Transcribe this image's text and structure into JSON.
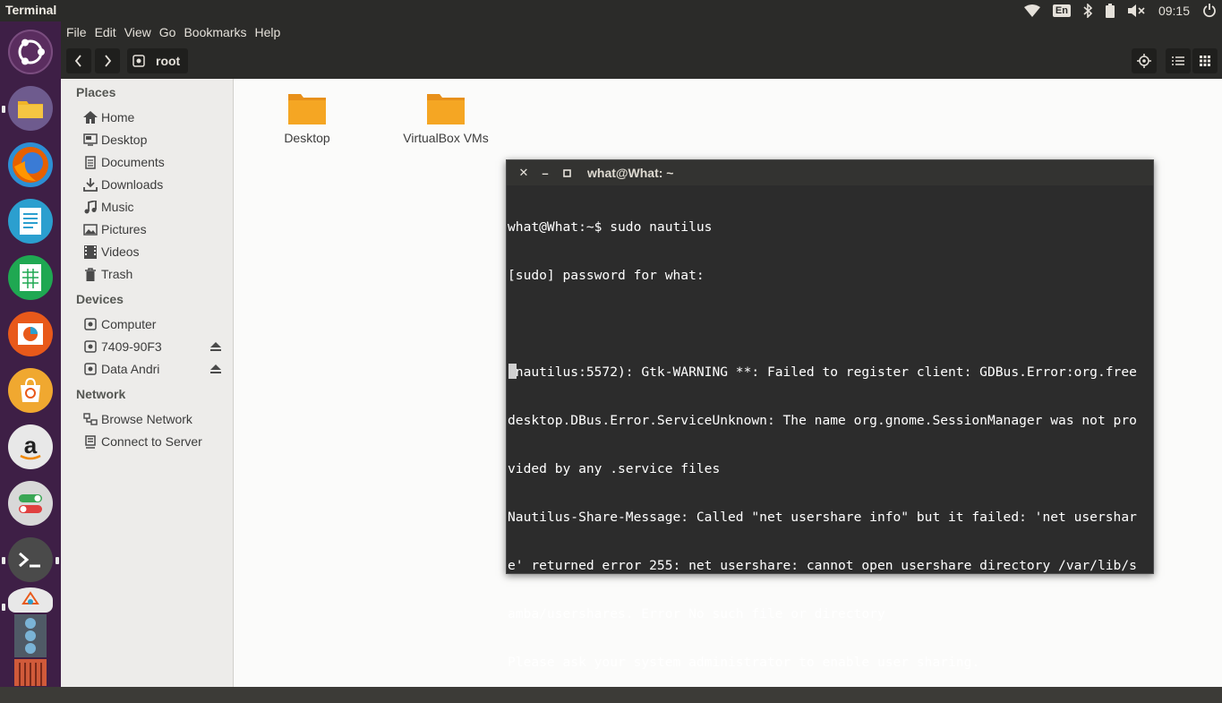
{
  "top_panel": {
    "app_title": "Terminal",
    "language": "En",
    "clock": "09:15",
    "icons": [
      "wifi-icon",
      "bluetooth-icon",
      "battery-icon",
      "volume-muted-icon",
      "power-icon"
    ]
  },
  "launcher": {
    "items": [
      {
        "name": "ubuntu-dash",
        "color": "#5a2d5f"
      },
      {
        "name": "files",
        "color": "#6e5b8e"
      },
      {
        "name": "firefox",
        "color": "#e66000"
      },
      {
        "name": "libreoffice-writer",
        "color": "#2b9fcf"
      },
      {
        "name": "libreoffice-calc",
        "color": "#1fa852"
      },
      {
        "name": "libreoffice-impress",
        "color": "#e8591a"
      },
      {
        "name": "ubuntu-software",
        "color": "#f0a830"
      },
      {
        "name": "amazon",
        "color": "#e8e8e8"
      },
      {
        "name": "system-settings",
        "color": "#d8d8d8"
      },
      {
        "name": "terminal",
        "color": "#4a4a4a"
      }
    ]
  },
  "file_manager": {
    "menu": [
      "File",
      "Edit",
      "View",
      "Go",
      "Bookmarks",
      "Help"
    ],
    "path_label": "root",
    "sidebar": {
      "places_heading": "Places",
      "places": [
        "Home",
        "Desktop",
        "Documents",
        "Downloads",
        "Music",
        "Pictures",
        "Videos",
        "Trash"
      ],
      "devices_heading": "Devices",
      "devices": [
        "Computer",
        "7409-90F3",
        "Data Andri"
      ],
      "network_heading": "Network",
      "network": [
        "Browse Network",
        "Connect to Server"
      ]
    },
    "files": [
      "Desktop",
      "VirtualBox VMs"
    ],
    "folder_color": "#f5a623"
  },
  "terminal": {
    "title": "what@What: ~",
    "lines": [
      "what@What:~$ sudo nautilus",
      "[sudo] password for what:",
      "",
      "(nautilus:5572): Gtk-WARNING **: Failed to register client: GDBus.Error:org.free",
      "desktop.DBus.Error.ServiceUnknown: The name org.gnome.SessionManager was not pro",
      "vided by any .service files",
      "Nautilus-Share-Message: Called \"net usershare info\" but it failed: 'net usershar",
      "e' returned error 255: net usershare: cannot open usershare directory /var/lib/s",
      "amba/usershares. Error No such file or directory",
      "Please ask your system administrator to enable user sharing."
    ]
  }
}
